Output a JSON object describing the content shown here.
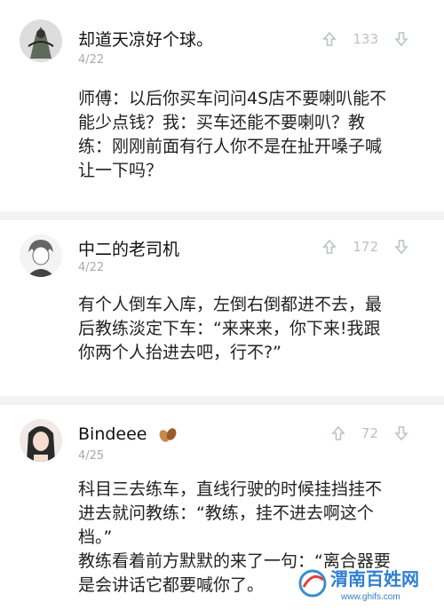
{
  "comments": [
    {
      "username": "却道天凉好个球。",
      "date": "4/22",
      "votes": "133",
      "lines": [
        "师傅：以后你买车问问4S店不要喇叭能不",
        "能少点钱？我：买车还能不要喇叭？教",
        "练：刚刚前面有行人你不是在扯开嗓子喊",
        "让一下吗？"
      ]
    },
    {
      "username": "中二的老司机",
      "date": "4/22",
      "votes": "172",
      "lines": [
        "有个人倒车入库，左倒右倒都进不去，最",
        "后教练淡定下车：“来来来，你下来!我跟",
        "你两个人抬进去吧，行不?”"
      ]
    },
    {
      "username": "Bindeee",
      "date": "4/25",
      "votes": "72",
      "lines": [
        "科目三去练车，直线行驶的时候挂挡挂不",
        "进去就问教练：“教练，挂不进去啊这个",
        "档。”",
        "教练看着前方默默的来了一句：“离合器要",
        "是会讲话它都要喊你了。"
      ]
    }
  ],
  "watermark": {
    "text": "渭南百姓网",
    "url": "www.ghifs.com"
  },
  "colors": {
    "icon": "#b9c3c7",
    "divider": "#f3f3f3",
    "date": "#aaaaaa"
  }
}
